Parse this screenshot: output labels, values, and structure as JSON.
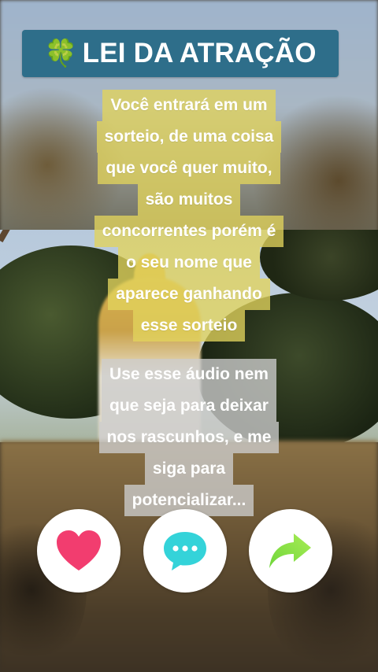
{
  "header": {
    "emoji": "🍀",
    "title": "LEI DA ATRAÇÃO"
  },
  "caption_main": {
    "lines": [
      "Você entrará em um",
      "sorteio, de uma coisa",
      "que você quer muito,",
      "são muitos",
      "concorrentes porém é",
      "o seu nome que",
      "aparece ganhando",
      "esse sorteio"
    ]
  },
  "caption_cta": {
    "lines": [
      "Use esse áudio nem",
      "que seja para deixar",
      "nos rascunhos, e me",
      "siga para",
      "potencializar..."
    ]
  },
  "actions": {
    "like_icon": "heart-icon",
    "comment_icon": "chat-bubble-icon",
    "share_icon": "share-arrow-icon",
    "colors": {
      "heart": "#f23d6f",
      "chat": "#34d3d9",
      "share": "#8fe03f"
    }
  }
}
